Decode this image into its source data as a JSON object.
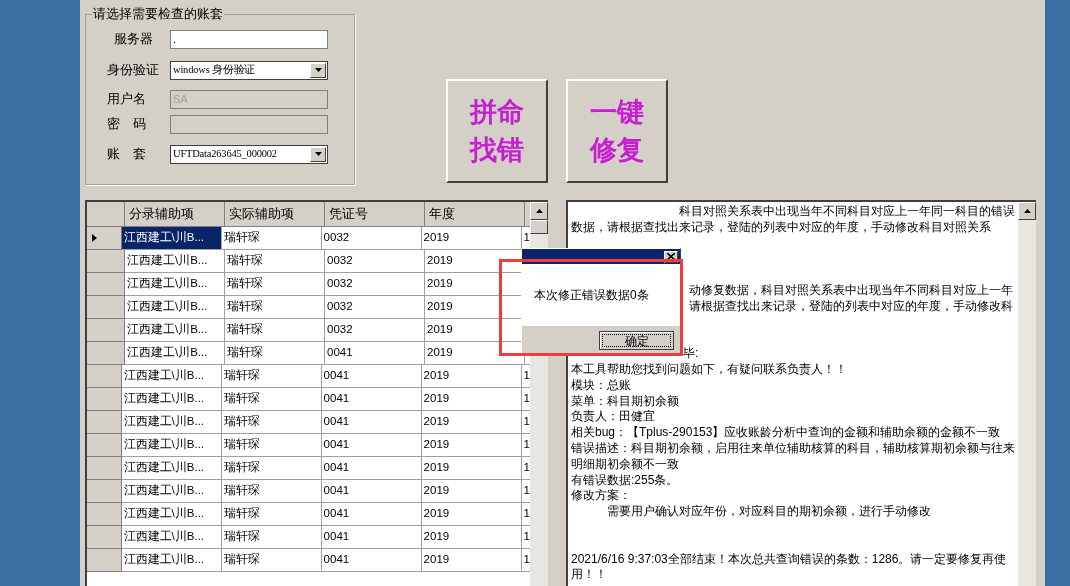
{
  "account_group": {
    "title": "请选择需要检查的账套",
    "fields": [
      {
        "label": "服务器",
        "kind": "input",
        "value": "."
      },
      {
        "label": "身份验证",
        "kind": "dropdown",
        "value": "windows 身份验证"
      },
      {
        "label": "用户名",
        "kind": "input",
        "value": "SA",
        "disabled": true
      },
      {
        "label": "密　码",
        "kind": "input",
        "disabled": true
      },
      {
        "label": "账　套",
        "kind": "dropdown",
        "value": "UFTData263645_000002"
      }
    ]
  },
  "action_buttons": [
    {
      "label": "拼命找错"
    },
    {
      "label": "一键修复"
    }
  ],
  "table": {
    "columns": [
      "分录辅助项",
      "实际辅助项",
      "凭证号",
      "年度"
    ],
    "rows": [
      {
        "selected": true,
        "cells": [
          "江西建工\\川B...",
          "瑞轩琛",
          "0032",
          "2019"
        ],
        "column_5": "1"
      },
      {
        "selected": false,
        "cells": [
          "江西建工\\川B...",
          "瑞轩琛",
          "0032",
          "2019"
        ]
      },
      {
        "selected": false,
        "cells": [
          "江西建工\\川B...",
          "瑞轩琛",
          "0032",
          "2019"
        ]
      },
      {
        "selected": false,
        "cells": [
          "江西建工\\川B...",
          "瑞轩琛",
          "0032",
          "2019"
        ]
      },
      {
        "selected": false,
        "cells": [
          "江西建工\\川B...",
          "瑞轩琛",
          "0032",
          "2019"
        ]
      },
      {
        "selected": false,
        "cells": [
          "江西建工\\川B...",
          "瑞轩琛",
          "0041",
          "2019"
        ]
      },
      {
        "selected": false,
        "cells": [
          "江西建工\\川B...",
          "瑞轩琛",
          "0041",
          "2019"
        ],
        "column_5": "1"
      },
      {
        "selected": false,
        "cells": [
          "江西建工\\川B...",
          "瑞轩琛",
          "0041",
          "2019"
        ],
        "column_5": "1"
      },
      {
        "selected": false,
        "cells": [
          "江西建工\\川B...",
          "瑞轩琛",
          "0041",
          "2019"
        ],
        "column_5": "1"
      },
      {
        "selected": false,
        "cells": [
          "江西建工\\川B...",
          "瑞轩琛",
          "0041",
          "2019"
        ],
        "column_5": "1"
      },
      {
        "selected": false,
        "cells": [
          "江西建工\\川B...",
          "瑞轩琛",
          "0041",
          "2019"
        ],
        "column_5": "1"
      },
      {
        "selected": false,
        "cells": [
          "江西建工\\川B...",
          "瑞轩琛",
          "0041",
          "2019"
        ],
        "column_5": "1"
      },
      {
        "selected": false,
        "cells": [
          "江西建工\\川B...",
          "瑞轩琛",
          "0041",
          "2019"
        ],
        "column_5": "1"
      },
      {
        "selected": false,
        "cells": [
          "江西建工\\川B...",
          "瑞轩琛",
          "0041",
          "2019"
        ],
        "column_5": "1"
      },
      {
        "selected": false,
        "cells": [
          "江西建工\\川B...",
          "瑞轩琛",
          "0041",
          "2019"
        ],
        "column_5": "1"
      }
    ]
  },
  "log": {
    "lines": [
      {
        "kind": "indented",
        "text": "科目对照关系表中出现当年不同科目对应上一年同一科目的错误"
      },
      {
        "kind": "plain",
        "text": "数据，请根据查找出来记录，登陆的列表中对应的年度，手动修改科目对照关系"
      },
      {
        "kind": "blank"
      },
      {
        "kind": "blank"
      },
      {
        "kind": "blank"
      },
      {
        "kind": "covered",
        "text": "动修复数据，科目对照关系表中出现当年不同科目对应上一年"
      },
      {
        "kind": "covered",
        "text": "请根据查找出来记录，登陆的列表中对应的年度，手动修改科"
      },
      {
        "kind": "blank"
      },
      {
        "kind": "blank"
      },
      {
        "kind": "covered",
        "text": "毕:"
      },
      {
        "kind": "plain",
        "text": "本工具帮助您找到问题如下，有疑问联系负责人！！"
      },
      {
        "kind": "plain",
        "text": "模块：总账"
      },
      {
        "kind": "plain",
        "text": "菜单：科目期初余额"
      },
      {
        "kind": "plain",
        "text": "负责人：田健宜"
      },
      {
        "kind": "plain",
        "text": "相关bug：【Tplus-290153】应收账龄分析中查询的金额和辅助余额的金额不一致"
      },
      {
        "kind": "plain",
        "text": "错误描述：科目期初余额，启用往来单位辅助核算的科目，辅助核算期初余额与往来"
      },
      {
        "kind": "plain",
        "text": "明细期初余额不一致"
      },
      {
        "kind": "plain",
        "text": "有错误数据:255条。"
      },
      {
        "kind": "plain",
        "text": "修改方案："
      },
      {
        "kind": "tabbed",
        "text": "需要用户确认对应年份，对应科目的期初余额，进行手动修改"
      },
      {
        "kind": "blank"
      },
      {
        "kind": "blank"
      },
      {
        "kind": "plain",
        "text": "2021/6/16 9:37:03全部结束！本次总共查询错误的条数：1286。请一定要修复再使"
      },
      {
        "kind": "plain",
        "text": "用！！"
      }
    ]
  },
  "dialog": {
    "message": "本次修正错误数据0条",
    "button": "确定"
  }
}
